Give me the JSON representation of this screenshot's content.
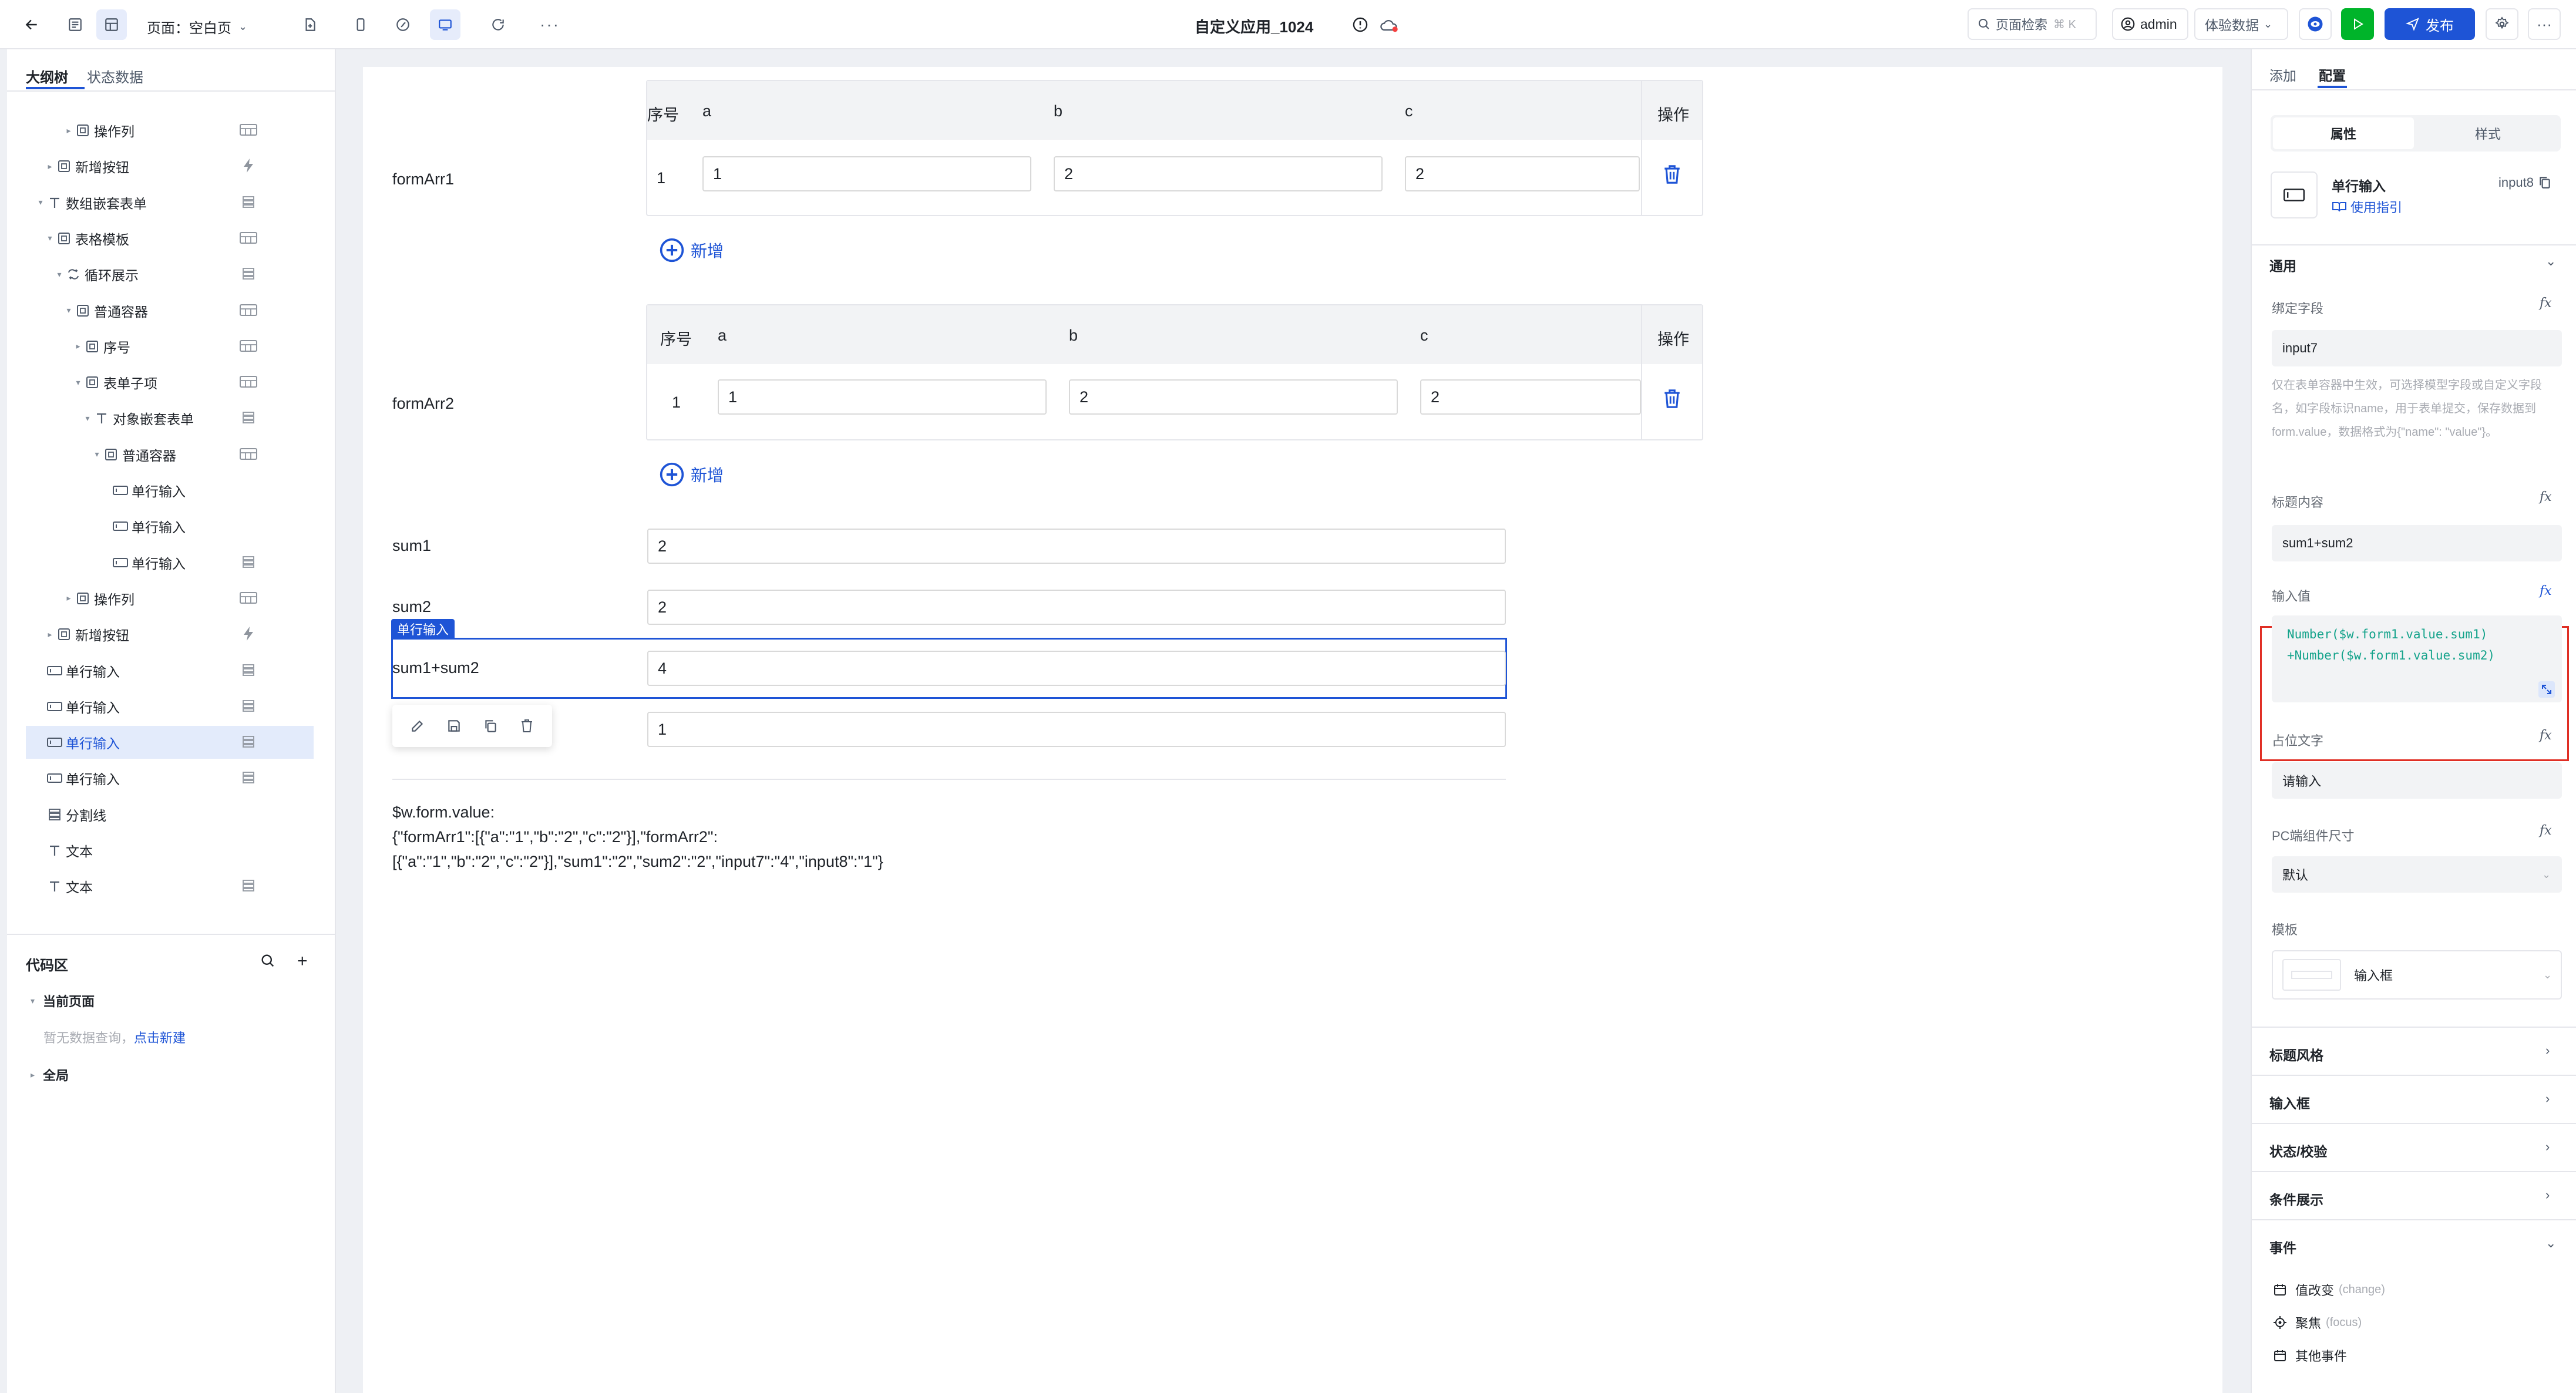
{
  "topbar": {
    "page_label": "页面：空白页",
    "app_title": "自定义应用_1024",
    "search_label": "页面检索",
    "search_shortcut": "⌘ K",
    "user": "admin",
    "env_select": "体验数据",
    "publish_label": "发布"
  },
  "left_panel": {
    "tabs": [
      "大纲树",
      "状态数据"
    ],
    "tree": [
      {
        "label": "操作列",
        "indent": 4,
        "icon": "box",
        "right": "table"
      },
      {
        "label": "新增按钮",
        "indent": 2,
        "icon": "box",
        "right": "bolt"
      },
      {
        "label": "数组嵌套表单",
        "indent": 1,
        "icon": "text",
        "right": "db"
      },
      {
        "label": "表格模板",
        "indent": 2,
        "icon": "box",
        "right": "table"
      },
      {
        "label": "循环展示",
        "indent": 3,
        "icon": "loop",
        "right": "db"
      },
      {
        "label": "普通容器",
        "indent": 4,
        "icon": "box",
        "right": "table"
      },
      {
        "label": "序号",
        "indent": 5,
        "icon": "box",
        "right": "table"
      },
      {
        "label": "表单子项",
        "indent": 5,
        "icon": "box",
        "right": "table"
      },
      {
        "label": "对象嵌套表单",
        "indent": 6,
        "icon": "text",
        "right": "db"
      },
      {
        "label": "普通容器",
        "indent": 7,
        "icon": "box",
        "right": "table"
      },
      {
        "label": "单行输入",
        "indent": 8,
        "icon": "input",
        "right": ""
      },
      {
        "label": "单行输入",
        "indent": 8,
        "icon": "input",
        "right": ""
      },
      {
        "label": "单行输入",
        "indent": 8,
        "icon": "input",
        "right": "db"
      },
      {
        "label": "操作列",
        "indent": 4,
        "icon": "box",
        "right": "table"
      },
      {
        "label": "新增按钮",
        "indent": 2,
        "icon": "box",
        "right": "bolt"
      },
      {
        "label": "单行输入",
        "indent": 1,
        "icon": "input",
        "right": "db"
      },
      {
        "label": "单行输入",
        "indent": 1,
        "icon": "input",
        "right": "db"
      },
      {
        "label": "单行输入",
        "indent": 1,
        "icon": "input",
        "right": "db",
        "selected": true
      },
      {
        "label": "单行输入",
        "indent": 1,
        "icon": "input",
        "right": "db"
      },
      {
        "label": "分割线",
        "indent": 1,
        "icon": "db",
        "right": ""
      },
      {
        "label": "文本",
        "indent": 1,
        "icon": "text",
        "right": ""
      },
      {
        "label": "文本",
        "indent": 1,
        "icon": "text",
        "right": "db"
      }
    ],
    "code_area": {
      "title": "代码区",
      "current_page": "当前页面",
      "empty_hint": "暂无数据查询，",
      "create_link": "点击新建",
      "global": "全局"
    }
  },
  "canvas": {
    "formArr1": {
      "label": "formArr1",
      "headers": [
        "序号",
        "a",
        "b",
        "c",
        "操作"
      ],
      "row": {
        "index": "1",
        "a": "1",
        "b": "2",
        "c": "2"
      },
      "add_label": "新增"
    },
    "formArr2": {
      "label": "formArr2",
      "headers": [
        "序号",
        "a",
        "b",
        "c",
        "操作"
      ],
      "row": {
        "index": "1",
        "a": "1",
        "b": "2",
        "c": "2"
      },
      "add_label": "新增"
    },
    "sum1": {
      "label": "sum1",
      "value": "2"
    },
    "sum2": {
      "label": "sum2",
      "value": "2"
    },
    "sum_total": {
      "label": "sum1+sum2",
      "value": "4",
      "tag": "单行输入"
    },
    "input8": {
      "label": "",
      "value": "1"
    },
    "output_title": "$w.form.value:",
    "output_line1": "{\"formArr1\":[{\"a\":\"1\",\"b\":\"2\",\"c\":\"2\"}],\"formArr2\":",
    "output_line2": "[{\"a\":\"1\",\"b\":\"2\",\"c\":\"2\"}],\"sum1\":\"2\",\"sum2\":\"2\",\"input7\":\"4\",\"input8\":\"1\"}"
  },
  "right_panel": {
    "tabs": [
      "添加",
      "配置"
    ],
    "subtabs": [
      "属性",
      "样式"
    ],
    "component": {
      "name": "单行输入",
      "id": "input8",
      "guide": "使用指引"
    },
    "section_general": "通用",
    "bind_field_label": "绑定字段",
    "bind_field_value": "input7",
    "bind_hint": "仅在表单容器中生效，可选择模型字段或自定义字段名，如字段标识name，用于表单提交，保存数据到form.value，数据格式为{\"name\": \"value\"}。",
    "title_label": "标题内容",
    "title_value": "sum1+sum2",
    "input_value_label": "输入值",
    "input_value_line1": "Number($w.form1.value.sum1)",
    "input_value_line2": "+Number($w.form1.value.sum2)",
    "placeholder_label": "占位文字",
    "placeholder_value": "请输入",
    "pc_size_label": "PC端组件尺寸",
    "pc_size_value": "默认",
    "template_label": "模板",
    "template_value": "输入框",
    "collapsed_sections": [
      "标题风格",
      "输入框",
      "状态/校验",
      "条件展示"
    ],
    "events_title": "事件",
    "events": [
      {
        "label": "值改变",
        "sub": "(change)"
      },
      {
        "label": "聚焦",
        "sub": "(focus)"
      },
      {
        "label": "其他事件",
        "sub": ""
      }
    ],
    "highlight_color": "#e02e24",
    "accent_color": "#1e54d6"
  }
}
